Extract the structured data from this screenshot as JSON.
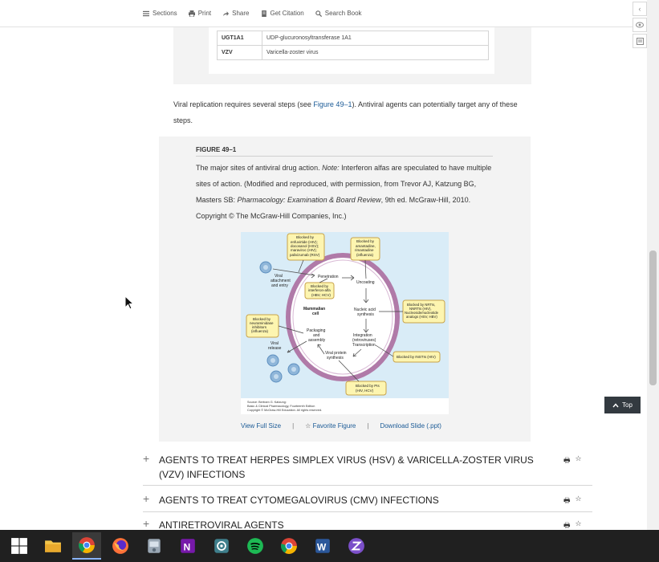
{
  "toolbar": {
    "sections": "Sections",
    "print": "Print",
    "share": "Share",
    "citation": "Get Citation",
    "search": "Search Book"
  },
  "abbreviations": [
    {
      "abbr": "UGT1A1",
      "meaning": "UDP-glucuronosyltransferase 1A1"
    },
    {
      "abbr": "VZV",
      "meaning": "Varicella-zoster virus"
    }
  ],
  "paragraph": {
    "before": "Viral replication requires several steps (see ",
    "link": "Figure 49–1",
    "after": "). Antiviral agents can potentially target any of these steps."
  },
  "figure": {
    "label": "FIGURE 49–1",
    "caption_1": "The major sites of antiviral drug action. ",
    "caption_note": "Note:",
    "caption_2": " Interferon alfas are speculated to have multiple sites of action. (Modified and reproduced, with permission, from Trevor AJ, Katzung BG, Masters SB: ",
    "caption_book": "Pharmacology: Examination & Board Review",
    "caption_3": ", 9th ed. McGraw-Hill, 2010. Copyright © The McGraw-Hill Companies, Inc.)",
    "diagram": {
      "blocks": {
        "entry": [
          "Blocked by",
          "enfuvirtide (HIV);",
          "docosanol (HSV);",
          "maraviroc (HIV);",
          "palivizumab (RSV)"
        ],
        "uncoating": [
          "Blocked by",
          "amantadine,",
          "rimantadine",
          "(influenza)"
        ],
        "interferon": [
          "Blocked by",
          "interferon-alfa",
          "(HBV, HCV)"
        ],
        "nrti": [
          "Blocked by NRTIs,",
          "NNRTIs (HIV),",
          "Nucleoside/nucleotide",
          "analogs (HSV, HBV)"
        ],
        "neuraminidase": [
          "Blocked by",
          "neuraminidase",
          "inhibitors",
          "(influenza)"
        ],
        "insti": [
          "Blocked by INSTIs (HIV)"
        ],
        "pi": [
          "Blocked by PIs",
          "(HIV, HCV)"
        ]
      },
      "steps": {
        "attachment": [
          "Viral",
          "attachment",
          "and entry"
        ],
        "penetration": "Penetration",
        "uncoating": "Uncoating",
        "cell": [
          "Mammalian",
          "cell"
        ],
        "nucleic": [
          "Nucleic acid",
          "synthesis"
        ],
        "integration": [
          "Integration",
          "(retroviruses)",
          "Transcription"
        ],
        "packaging": [
          "Packaging",
          "and",
          "assembly"
        ],
        "protein": [
          "Viral protein",
          "synthesis"
        ],
        "release": [
          "Viral",
          "release"
        ]
      },
      "source": [
        "Source: Bertram G. Katzung:",
        "Basic & Clinical Pharmacology, Fourteenth Edition",
        "Copyright © McGraw-Hill Education. All rights reserved."
      ]
    },
    "view_full": "View Full Size",
    "sep": "|",
    "favorite": "Favorite Figure",
    "download": "Download Slide (.ppt)"
  },
  "sections": [
    {
      "title": "AGENTS TO TREAT HERPES SIMPLEX VIRUS (HSV) & VARICELLA-ZOSTER VIRUS (VZV) INFECTIONS"
    },
    {
      "title": "AGENTS TO TREAT CYTOMEGALOVIRUS (CMV) INFECTIONS"
    },
    {
      "title": "ANTIRETROVIRAL AGENTS"
    }
  ],
  "top_button": "Top",
  "colors": {
    "link": "#1a5a96",
    "block_fill": "#fdf5b0",
    "block_stroke": "#c8a24a",
    "membrane": "#b07aa8",
    "virus": "#8fb6d9"
  }
}
